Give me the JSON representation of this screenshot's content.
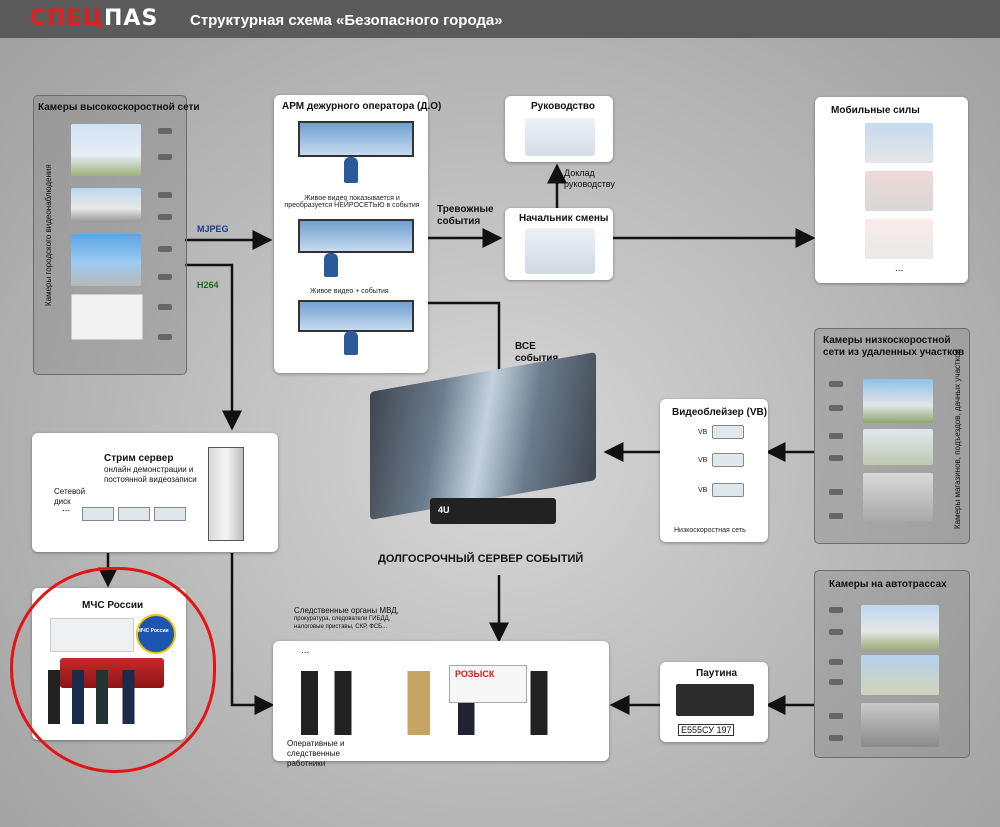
{
  "header": {
    "logo_part1": "СПЕЦ",
    "logo_part2": "ПАS",
    "title": "Структурная схема «Безопасного города»"
  },
  "hs_cameras": {
    "title": "Камеры высокоскоростной сети",
    "vertical": "Камеры городского видеонаблюдения"
  },
  "arm": {
    "title": "АРМ дежурного оператора (Д.О)",
    "caption1": "Живое видео показывается и преобразуется НЕЙРОСЕТЬЮ в события",
    "caption2": "Живое видео + события"
  },
  "flows": {
    "mjpeg": "MJPEG",
    "h264": "H264",
    "alarm": "Тревожные события",
    "all_events": "ВСЕ события",
    "report": "Доклад руководству"
  },
  "management": {
    "title": "Руководство"
  },
  "shift_chief": {
    "title": "Начальник смены"
  },
  "mobile": {
    "title": "Мобильные силы",
    "more": "..."
  },
  "ls_cameras": {
    "title": "Камеры низкоскоростной сети из удаленных участков",
    "vertical": "Камеры магазинов, подъездов, дачных участков"
  },
  "vb": {
    "title": "Видеоблейзер (VB)",
    "item": "VB",
    "footer": "Низкоскоростная сеть"
  },
  "stream": {
    "title": "Стрим сервер",
    "desc": "онлайн демонстрации и постоянной видеозаписи",
    "disk": "Сетевой диск",
    "dots": "..."
  },
  "server": {
    "title": "ДОЛГОСРОЧНЫЙ СЕРВЕР СОБЫТИЙ",
    "badge": "4U"
  },
  "mchs": {
    "title": "МЧС России",
    "emblem": "МЧС России"
  },
  "invest": {
    "bodies": "Следственные органы МВД,",
    "bodies2": "прокуратура, следователи ГИБДД,",
    "bodies3": "налоговые приставы, СКР, ФСБ...",
    "dots": "...",
    "wanted": "РОЗЫСК",
    "workers": "Оперативные и следственные работники"
  },
  "highway": {
    "title": "Камеры на автотрассах"
  },
  "pautina": {
    "title": "Паутина",
    "plate": "Е555СУ 197"
  },
  "colors": {
    "header_bg": "#5a5a5a",
    "logo_red": "#e02020",
    "mjpeg": "#1a3a9a",
    "h264": "#1e6a1e",
    "highlight": "#e31414"
  }
}
